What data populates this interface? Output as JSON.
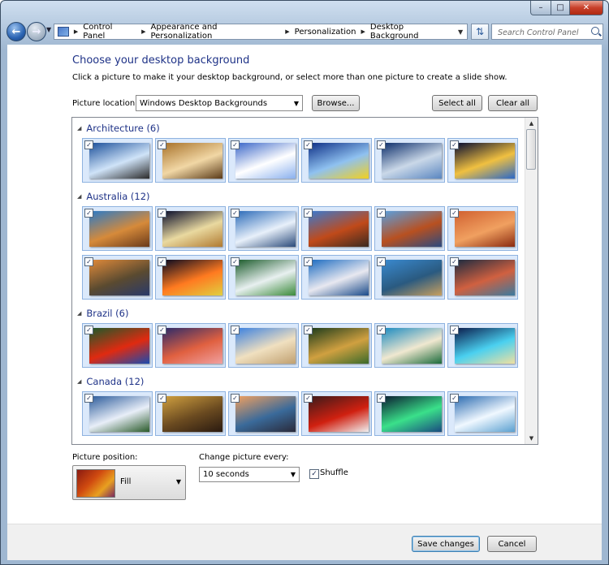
{
  "search": {
    "placeholder": "Search Control Panel"
  },
  "breadcrumb": [
    "Control Panel",
    "Appearance and Personalization",
    "Personalization",
    "Desktop Background"
  ],
  "page": {
    "title": "Choose your desktop background",
    "subtitle": "Click a picture to make it your desktop background, or select more than one picture to create a slide show."
  },
  "location": {
    "label": "Picture location:",
    "value": "Windows Desktop Backgrounds",
    "browse": "Browse...",
    "select_all": "Select all",
    "clear_all": "Clear all"
  },
  "groups": [
    {
      "title": "Architecture (6)",
      "images": [
        [
          "#1b4f9a",
          "#cfe3f8",
          "#2a2a2a"
        ],
        [
          "#a8722a",
          "#f1d7a5",
          "#5a3a18"
        ],
        [
          "#3a66c8",
          "#ffffff",
          "#8ab0ee"
        ],
        [
          "#0e2f86",
          "#8fc1f0",
          "#f2d020"
        ],
        [
          "#0c2d6a",
          "#cad8e8",
          "#5a86c0"
        ],
        [
          "#050a30",
          "#f0c040",
          "#2a68c8"
        ]
      ]
    },
    {
      "title": "Australia (12)",
      "images": [
        [
          "#2a7ac8",
          "#d68a3a",
          "#6a3a1a"
        ],
        [
          "#070b2a",
          "#e9d9a0",
          "#b07a30"
        ],
        [
          "#2a6ab8",
          "#e8f0fa",
          "#2a4a7a"
        ],
        [
          "#3a7ad0",
          "#c04a1a",
          "#3a2a20"
        ],
        [
          "#5aa0e0",
          "#b85020",
          "#2a4a80"
        ],
        [
          "#d06030",
          "#f0a060",
          "#8a2a10"
        ],
        [
          "#e08a3a",
          "#5a4a30",
          "#2a3a6a"
        ],
        [
          "#060820",
          "#ff7a20",
          "#e0d040"
        ],
        [
          "#1a5a2a",
          "#e8f0f0",
          "#3a8a3a"
        ],
        [
          "#1a6ac0",
          "#e8e8f0",
          "#1a4a8a"
        ],
        [
          "#3a8ad0",
          "#2a5a80",
          "#c8a060"
        ],
        [
          "#1a2a40",
          "#d06040",
          "#3a7aa0"
        ]
      ]
    },
    {
      "title": "Brazil (6)",
      "images": [
        [
          "#1a5a2a",
          "#e02a10",
          "#1a4ab0"
        ],
        [
          "#2a2a6a",
          "#e06040",
          "#f0a0a0"
        ],
        [
          "#3a80e0",
          "#f0e0c0",
          "#c0a070"
        ],
        [
          "#1a3a1a",
          "#d0a040",
          "#3a6a2a"
        ],
        [
          "#1a8ac0",
          "#f0e8d0",
          "#1a6a3a"
        ],
        [
          "#0a1a4a",
          "#4ad0f0",
          "#f0e0a0"
        ]
      ]
    },
    {
      "title": "Canada (12)",
      "images": [
        [
          "#2a5a9a",
          "#e8eef8",
          "#2a5a2a"
        ],
        [
          "#d0a040",
          "#6a4a20",
          "#2a1a10"
        ],
        [
          "#f0a060",
          "#3a6a9a",
          "#2a2a3a"
        ],
        [
          "#3a1a1a",
          "#d02010",
          "#f0f0f0"
        ],
        [
          "#0a1a30",
          "#3ae08a",
          "#1a4a80"
        ],
        [
          "#2a6ab0",
          "#f0f8ff",
          "#5aa0d0"
        ]
      ]
    }
  ],
  "position": {
    "label": "Picture position:",
    "value": "Fill"
  },
  "interval": {
    "label": "Change picture every:",
    "value": "10 seconds"
  },
  "shuffle": {
    "label": "Shuffle",
    "checked": true
  },
  "footer": {
    "save": "Save changes",
    "cancel": "Cancel"
  }
}
